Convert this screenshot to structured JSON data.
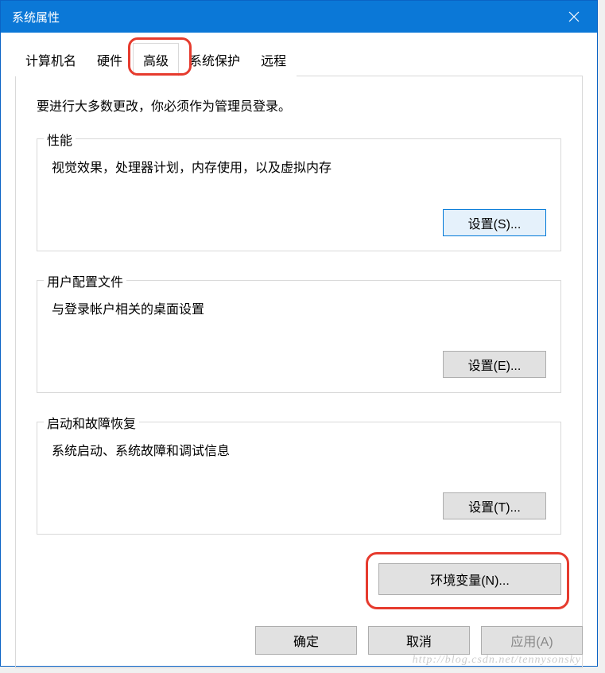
{
  "titlebar": {
    "title": "系统属性"
  },
  "tabs": [
    {
      "label": "计算机名"
    },
    {
      "label": "硬件"
    },
    {
      "label": "高级"
    },
    {
      "label": "系统保护"
    },
    {
      "label": "远程"
    }
  ],
  "intro": "要进行大多数更改，你必须作为管理员登录。",
  "groups": {
    "performance": {
      "title": "性能",
      "desc": "视觉效果，处理器计划，内存使用，以及虚拟内存",
      "button": "设置(S)..."
    },
    "userProfile": {
      "title": "用户配置文件",
      "desc": "与登录帐户相关的桌面设置",
      "button": "设置(E)..."
    },
    "startup": {
      "title": "启动和故障恢复",
      "desc": "系统启动、系统故障和调试信息",
      "button": "设置(T)..."
    }
  },
  "envVarButton": "环境变量(N)...",
  "footer": {
    "ok": "确定",
    "cancel": "取消",
    "apply": "应用(A)"
  },
  "watermark": "http://blog.csdn.net/tennysonsky"
}
